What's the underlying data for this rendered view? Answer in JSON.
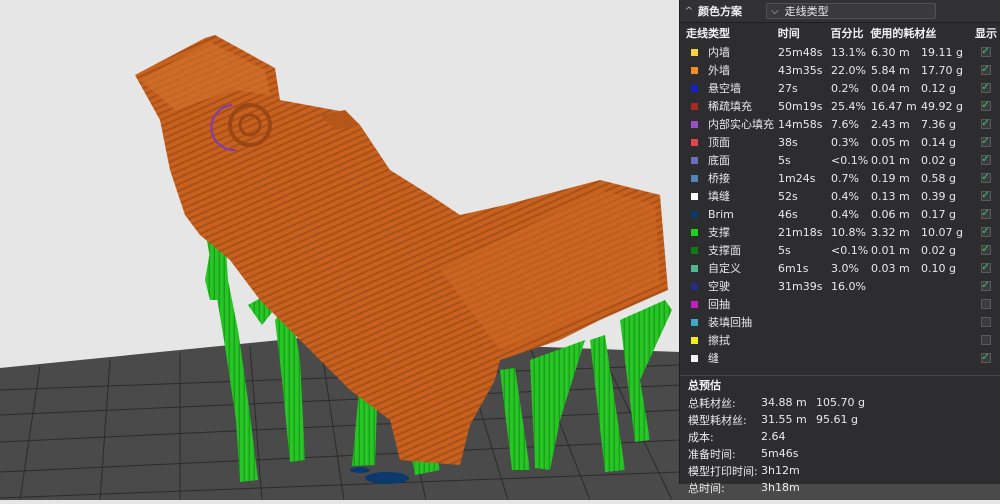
{
  "panel": {
    "caret": "^",
    "title": "颜色方案",
    "scheme_value": "走线类型",
    "headers": {
      "type": "走线类型",
      "time": "时间",
      "percent": "百分比",
      "used": "使用的耗材丝",
      "show": "显示"
    },
    "rows": [
      {
        "label": "内墙",
        "color": "#f6d33c",
        "time": "25m48s",
        "percent": "13.1%",
        "length": "6.30 m",
        "weight": "19.11 g",
        "show": true
      },
      {
        "label": "外墙",
        "color": "#f28c2c",
        "time": "43m35s",
        "percent": "22.0%",
        "length": "5.84 m",
        "weight": "17.70 g",
        "show": true
      },
      {
        "label": "悬空墙",
        "color": "#1622c9",
        "time": "27s",
        "percent": "0.2%",
        "length": "0.04 m",
        "weight": "0.12 g",
        "show": true
      },
      {
        "label": "稀疏填充",
        "color": "#a52a22",
        "time": "50m19s",
        "percent": "25.4%",
        "length": "16.47 m",
        "weight": "49.92 g",
        "show": true
      },
      {
        "label": "内部实心填充",
        "color": "#9b4fc7",
        "time": "14m58s",
        "percent": "7.6%",
        "length": "2.43 m",
        "weight": "7.36 g",
        "show": true
      },
      {
        "label": "顶面",
        "color": "#e0474c",
        "time": "38s",
        "percent": "0.3%",
        "length": "0.05 m",
        "weight": "0.14 g",
        "show": true
      },
      {
        "label": "底面",
        "color": "#6c6cc0",
        "time": "5s",
        "percent": "<0.1%",
        "length": "0.01 m",
        "weight": "0.02 g",
        "show": true
      },
      {
        "label": "桥接",
        "color": "#4d86b8",
        "time": "1m24s",
        "percent": "0.7%",
        "length": "0.19 m",
        "weight": "0.58 g",
        "show": true
      },
      {
        "label": "填缝",
        "color": "#ffffff",
        "time": "52s",
        "percent": "0.4%",
        "length": "0.13 m",
        "weight": "0.39 g",
        "show": true
      },
      {
        "label": "Brim",
        "color": "#0b3a6e",
        "time": "46s",
        "percent": "0.4%",
        "length": "0.06 m",
        "weight": "0.17 g",
        "show": true
      },
      {
        "label": "支撑",
        "color": "#1fd11f",
        "time": "21m18s",
        "percent": "10.8%",
        "length": "3.32 m",
        "weight": "10.07 g",
        "show": true
      },
      {
        "label": "支撑面",
        "color": "#127a12",
        "time": "5s",
        "percent": "<0.1%",
        "length": "0.01 m",
        "weight": "0.02 g",
        "show": true
      },
      {
        "label": "自定义",
        "color": "#4fb88f",
        "time": "6m1s",
        "percent": "3.0%",
        "length": "0.03 m",
        "weight": "0.10 g",
        "show": true
      },
      {
        "label": "空驶",
        "color": "#2a2a8a",
        "time": "31m39s",
        "percent": "16.0%",
        "length": "",
        "weight": "",
        "show": true
      },
      {
        "label": "回抽",
        "color": "#c21fc2",
        "time": "",
        "percent": "",
        "length": "",
        "weight": "",
        "show": false
      },
      {
        "label": "装填回抽",
        "color": "#3fa8c6",
        "time": "",
        "percent": "",
        "length": "",
        "weight": "",
        "show": false
      },
      {
        "label": "擦拭",
        "color": "#f5ee1a",
        "time": "",
        "percent": "",
        "length": "",
        "weight": "",
        "show": false
      },
      {
        "label": "缝",
        "color": "#f2f2f2",
        "time": "",
        "percent": "",
        "length": "",
        "weight": "",
        "show": true
      }
    ],
    "summary": {
      "title": "总预估",
      "rows": [
        {
          "key": "总耗材丝:",
          "v1": "34.88 m",
          "v2": "105.70 g"
        },
        {
          "key": "模型耗材丝:",
          "v1": "31.55 m",
          "v2": "95.61 g"
        },
        {
          "key": "成本:",
          "v1": "2.64",
          "v2": ""
        },
        {
          "key": "准备时间:",
          "v1": "5m46s",
          "v2": ""
        },
        {
          "key": "模型打印时间:",
          "v1": "3h12m",
          "v2": ""
        },
        {
          "key": "总时间:",
          "v1": "3h18m",
          "v2": ""
        }
      ]
    }
  },
  "scene": {
    "background_color": "#e6e6e6",
    "bed_color": "#4a4a4a",
    "model_color": "#c8611e",
    "support_color": "#22c81e",
    "brim_color": "#0b3a6e"
  }
}
